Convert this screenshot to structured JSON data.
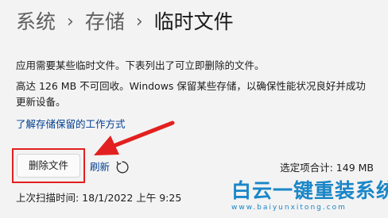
{
  "breadcrumb": {
    "level1": "系统",
    "level2": "存储",
    "current": "临时文件",
    "separator": "›"
  },
  "description": {
    "line1": "应用需要某些临时文件。下表列出了可立即删除的文件。",
    "line2": "高达 126 MB 不可回收。Windows 保留某些存储，以确保性能状况良好并成功更新设备。"
  },
  "learn_link": "了解存储保留的工作方式",
  "actions": {
    "delete_label": "删除文件",
    "refresh_label": "刷新"
  },
  "selected_total": "选定项合计: 149 MB",
  "last_scan": "上次扫描时间: 18/1/2022 上午 9:25",
  "watermark": {
    "title": "白云一键重装系统",
    "url": "www.baiyunxitong.com"
  },
  "colors": {
    "background": "#f3f3f3",
    "link": "#003e92",
    "highlight_red": "#e2201f",
    "watermark_blue": "#1a86c8"
  },
  "icons": {
    "refresh": "refresh-icon",
    "annotation": "arrow-icon",
    "logo": "bird-logo-icon"
  }
}
